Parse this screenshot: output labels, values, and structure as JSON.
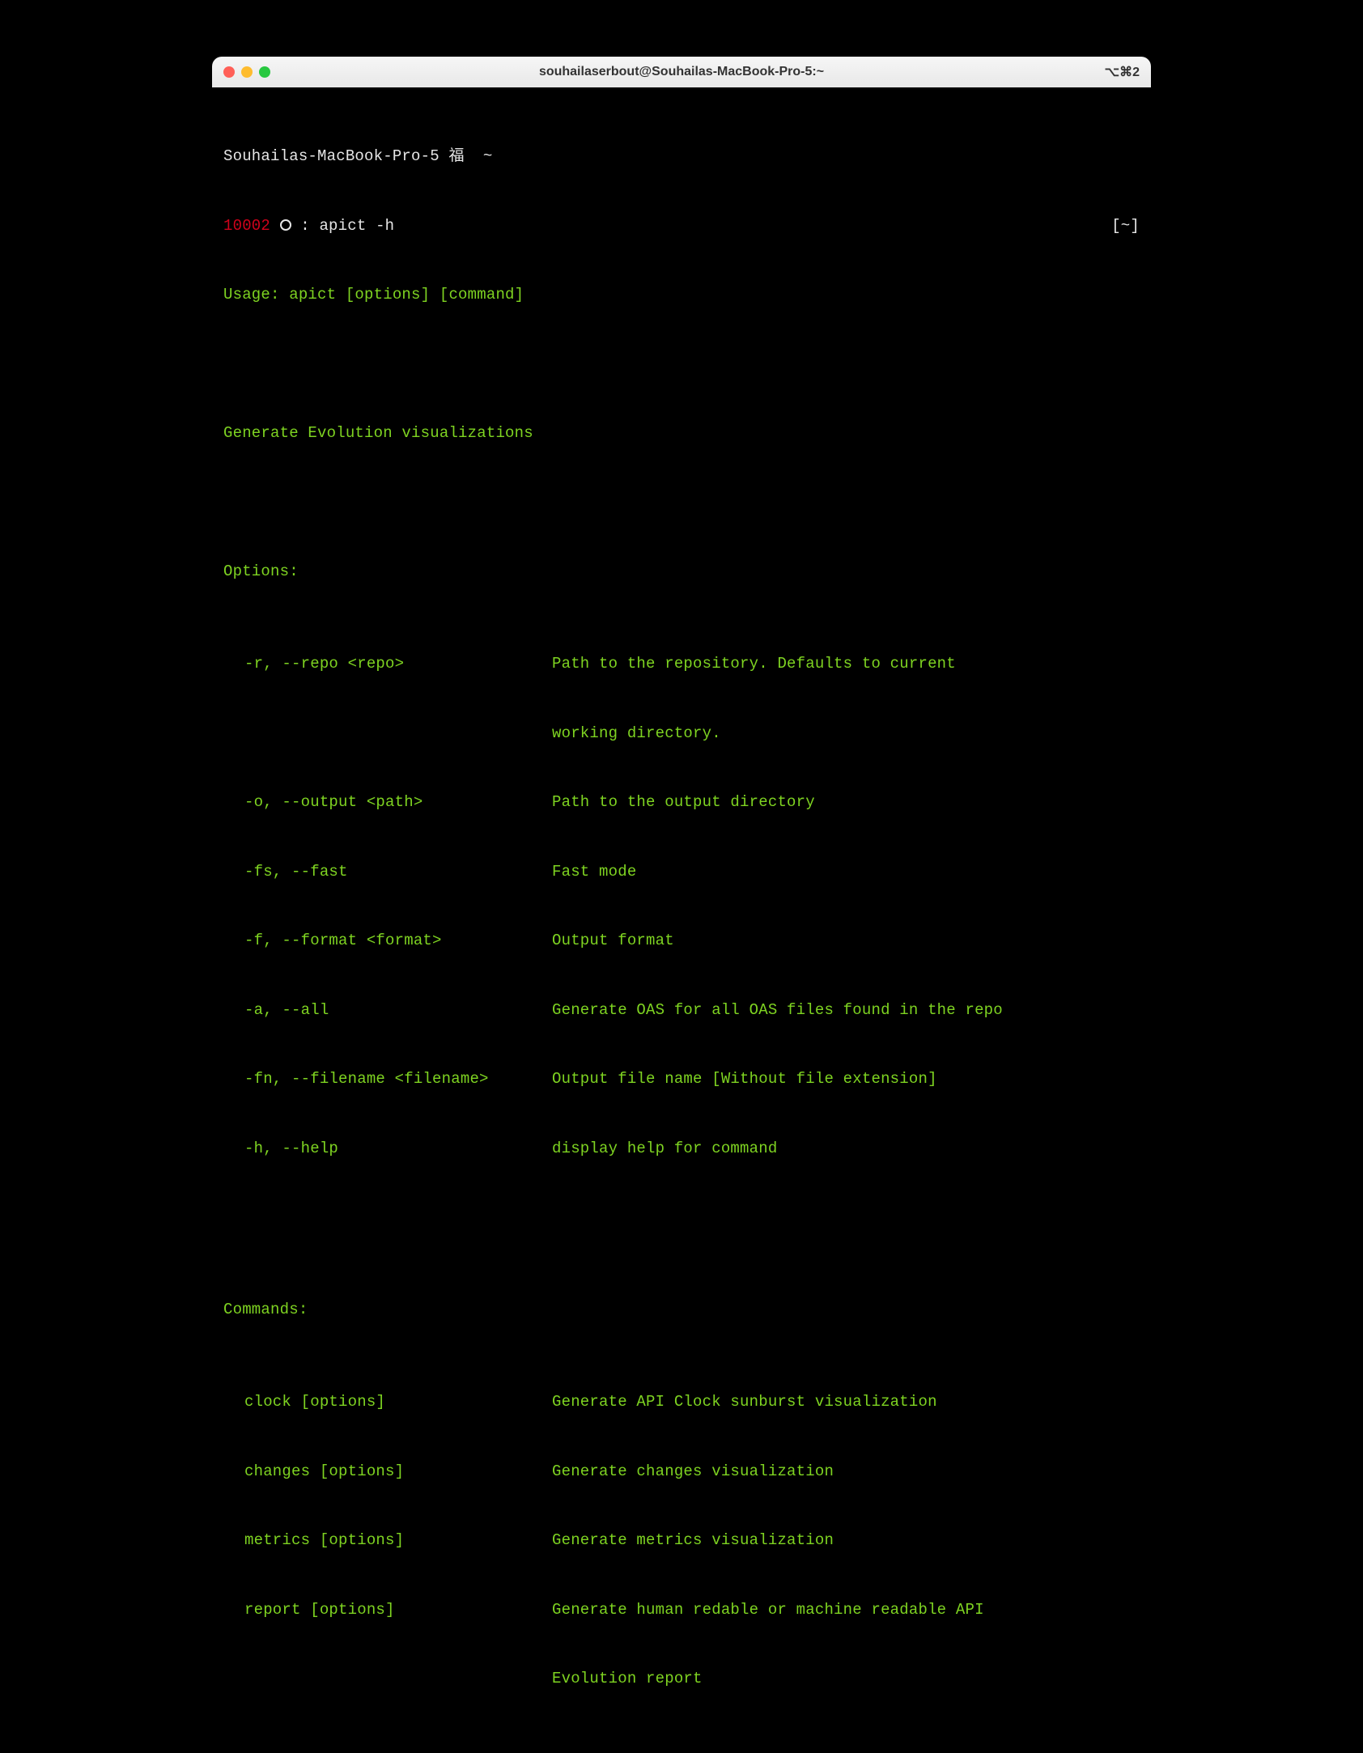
{
  "window": {
    "title": "souhailaserbout@Souhailas-MacBook-Pro-5:~",
    "shortcut": "⌥⌘2"
  },
  "prompt": {
    "hostname": "Souhailas-MacBook-Pro-5",
    "symbol1": "福",
    "tilde": "~",
    "counter": "10002",
    "separator": ":",
    "command": "apict -h",
    "cwd": "[~]"
  },
  "output": {
    "usage": "Usage: apict [options] [command]",
    "description": "Generate Evolution visualizations",
    "options_header": "Options:",
    "options": [
      {
        "flag": "-r, --repo <repo>",
        "desc": "Path to the repository. Defaults to current",
        "cont": "working directory."
      },
      {
        "flag": "-o, --output <path>",
        "desc": "Path to the output directory"
      },
      {
        "flag": "-fs, --fast",
        "desc": "Fast mode"
      },
      {
        "flag": "-f, --format <format>",
        "desc": "Output format"
      },
      {
        "flag": "-a, --all",
        "desc": "Generate OAS for all OAS files found in the repo"
      },
      {
        "flag": "-fn, --filename <filename>",
        "desc": "Output file name [Without file extension]"
      },
      {
        "flag": "-h, --help",
        "desc": "display help for command"
      }
    ],
    "commands_header": "Commands:",
    "commands": [
      {
        "flag": "clock [options]",
        "desc": "Generate API Clock sunburst visualization"
      },
      {
        "flag": "changes [options]",
        "desc": "Generate changes visualization"
      },
      {
        "flag": "metrics [options]",
        "desc": "Generate metrics visualization"
      },
      {
        "flag": "report [options]",
        "desc": "Generate human redable or machine readable API",
        "cont": "Evolution report"
      }
    ]
  }
}
